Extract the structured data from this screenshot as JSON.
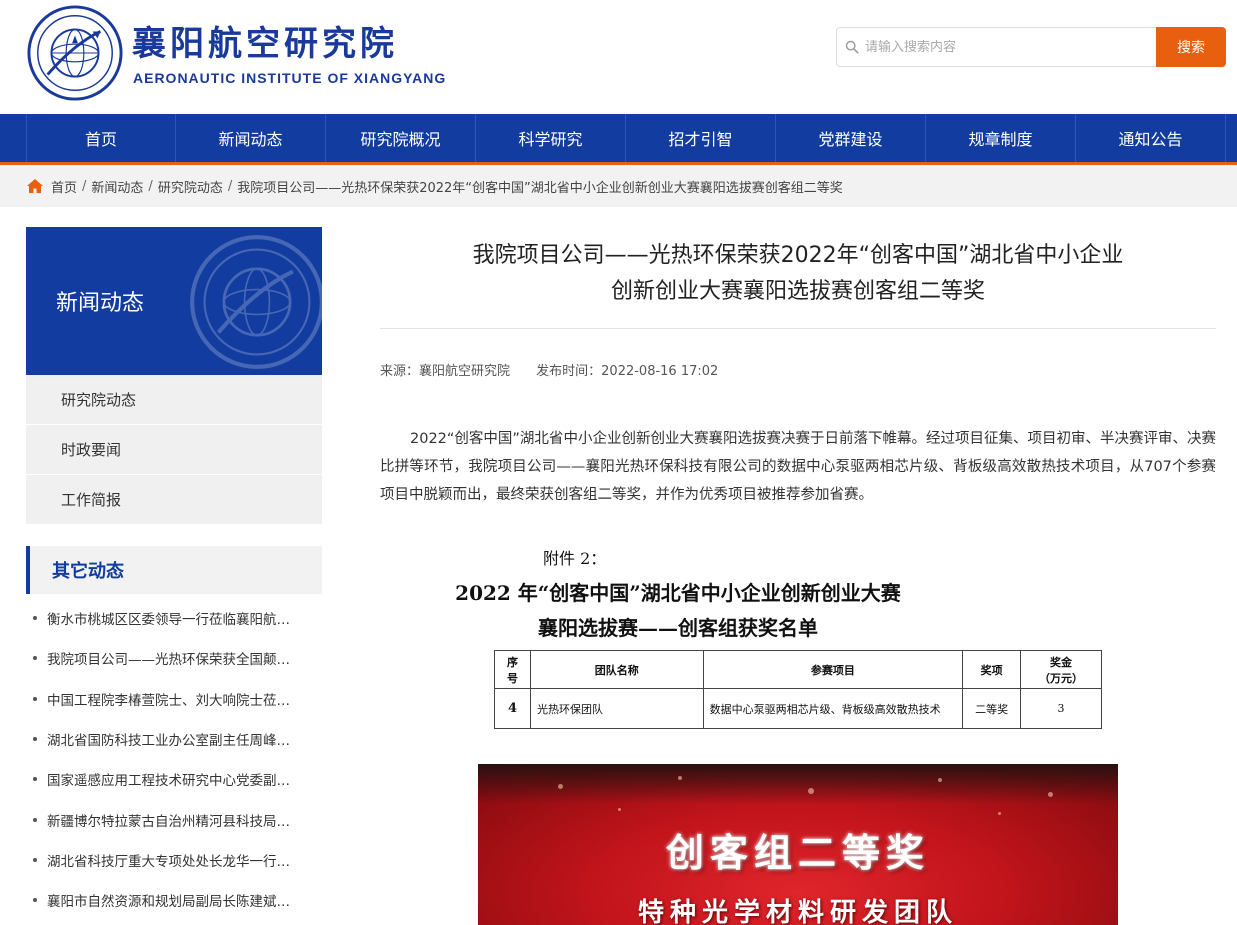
{
  "header": {
    "logo_cn": "襄阳航空研究院",
    "logo_en": "AERONAUTIC INSTITUTE OF XIANGYANG",
    "logo_seal_text": "AERONAUTIC INSTITUTE OF XIANGYANG 襄阳航空研究院",
    "search_placeholder": "请输入搜索内容",
    "search_button": "搜索"
  },
  "nav": {
    "items": [
      "首页",
      "新闻动态",
      "研究院概况",
      "科学研究",
      "招才引智",
      "党群建设",
      "规章制度",
      "通知公告"
    ]
  },
  "breadcrumb": {
    "items": [
      "首页",
      "新闻动态",
      "研究院动态",
      "我院项目公司——光热环保荣获2022年“创客中国”湖北省中小企业创新创业大赛襄阳选拔赛创客组二等奖"
    ],
    "separator": "/"
  },
  "sidebar": {
    "title": "新闻动态",
    "menu": [
      "研究院动态",
      "时政要闻",
      "工作简报"
    ],
    "other_title": "其它动态",
    "other_items": [
      "衡水市桃城区区委领导一行莅临襄阳航…",
      "我院项目公司——光热环保荣获全国颠…",
      "中国工程院李椿萱院士、刘大响院士莅…",
      "湖北省国防科技工业办公室副主任周峰…",
      "国家遥感应用工程技术研究中心党委副…",
      "新疆博尔特拉蒙古自治州精河县科技局…",
      "湖北省科技厅重大专项处处长龙华一行…",
      "襄阳市自然资源和规划局副局长陈建斌…"
    ]
  },
  "article": {
    "title_line1": "我院项目公司——光热环保荣获2022年“创客中国”湖北省中小企业",
    "title_line2": "创新创业大赛襄阳选拔赛创客组二等奖",
    "source": "来源：襄阳航空研究院",
    "publish_time": "发布时间：2022-08-16 17:02",
    "body": "2022“创客中国”湖北省中小企业创新创业大赛襄阳选拔赛决赛于日前落下帷幕。经过项目征集、项目初审、半决赛评审、决赛比拼等环节，我院项目公司——襄阳光热环保科技有限公司的数据中心泵驱两相芯片级、背板级高效散热技术项目，从707个参赛项目中脱颖而出，最终荣获创客组二等奖，并作为优秀项目被推荐参加省赛。"
  },
  "document": {
    "attachment": "附件 2：",
    "title1": "2022 年“创客中国”湖北省中小企业创新创业大赛",
    "title2": "襄阳选拔赛——创客组获奖名单",
    "headers": [
      "序号",
      "团队名称",
      "参赛项目",
      "奖项",
      "奖金（万元）"
    ],
    "header_lines": {
      "h0a": "序",
      "h0b": "号",
      "h4a": "奖金",
      "h4b": "（万元）"
    },
    "rows": [
      {
        "no": "4",
        "team": "光热环保团队",
        "project": "数据中心泵驱两相芯片级、背板级高效散热技术",
        "award": "二等奖",
        "bonus": "3"
      }
    ]
  },
  "photo": {
    "line1": "创客组二等奖",
    "line2": "特种光学材料研发团队"
  },
  "colors": {
    "primary_blue": "#123ca0",
    "accent_orange": "#e8600f"
  }
}
